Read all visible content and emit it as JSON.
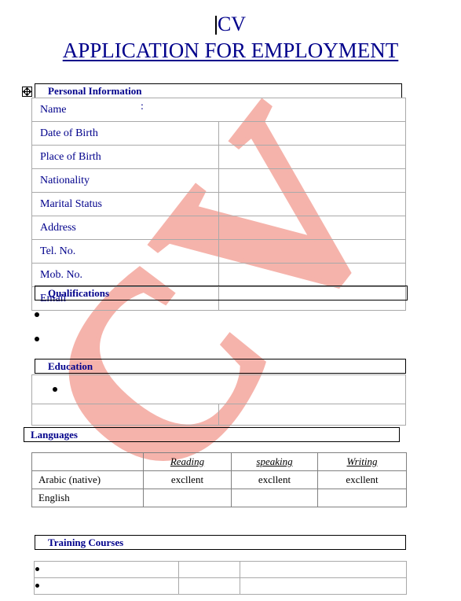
{
  "document": {
    "title_line1": "CV",
    "title_line2": "APPLICATION FOR EMPLOYMENT",
    "text_color": "#00008b",
    "watermark_text": "CV",
    "watermark_color": "#f5b3ab"
  },
  "personal_information": {
    "header": "Personal Information",
    "name_label": "Name",
    "name_colon": ":",
    "name_value": "",
    "rows": [
      {
        "label": "Date of Birth",
        "value": ""
      },
      {
        "label": "Place of Birth",
        "value": ""
      },
      {
        "label": "Nationality",
        "value": ""
      },
      {
        "label": "Marital Status",
        "value": ""
      },
      {
        "label": "Address",
        "value": ""
      },
      {
        "label": "Tel. No.",
        "value": ""
      },
      {
        "label": "Mob. No.",
        "value": ""
      },
      {
        "label": "Email",
        "value": ""
      }
    ]
  },
  "qualifications": {
    "header": "Qualifications",
    "bullets": [
      "",
      ""
    ]
  },
  "education": {
    "header": "Education",
    "bullet_row": "",
    "detail_row": {
      "left": "",
      "right": ""
    }
  },
  "languages": {
    "header": "Languages",
    "columns": [
      "",
      "Reading",
      "speaking",
      "Writing"
    ],
    "rows": [
      {
        "language": "Arabic (native)",
        "reading": "excllent",
        "speaking": "excllent",
        "writing": "excllent"
      },
      {
        "language": "English",
        "reading": "",
        "speaking": "",
        "writing": ""
      }
    ]
  },
  "training_courses": {
    "header": "Training Courses",
    "rows": [
      {
        "course": "",
        "col2": "",
        "col3": ""
      },
      {
        "course": "",
        "col2": "",
        "col3": ""
      }
    ]
  },
  "icons": {
    "table_move_handle": "move-cross-icon",
    "text_caret": "text-cursor"
  }
}
